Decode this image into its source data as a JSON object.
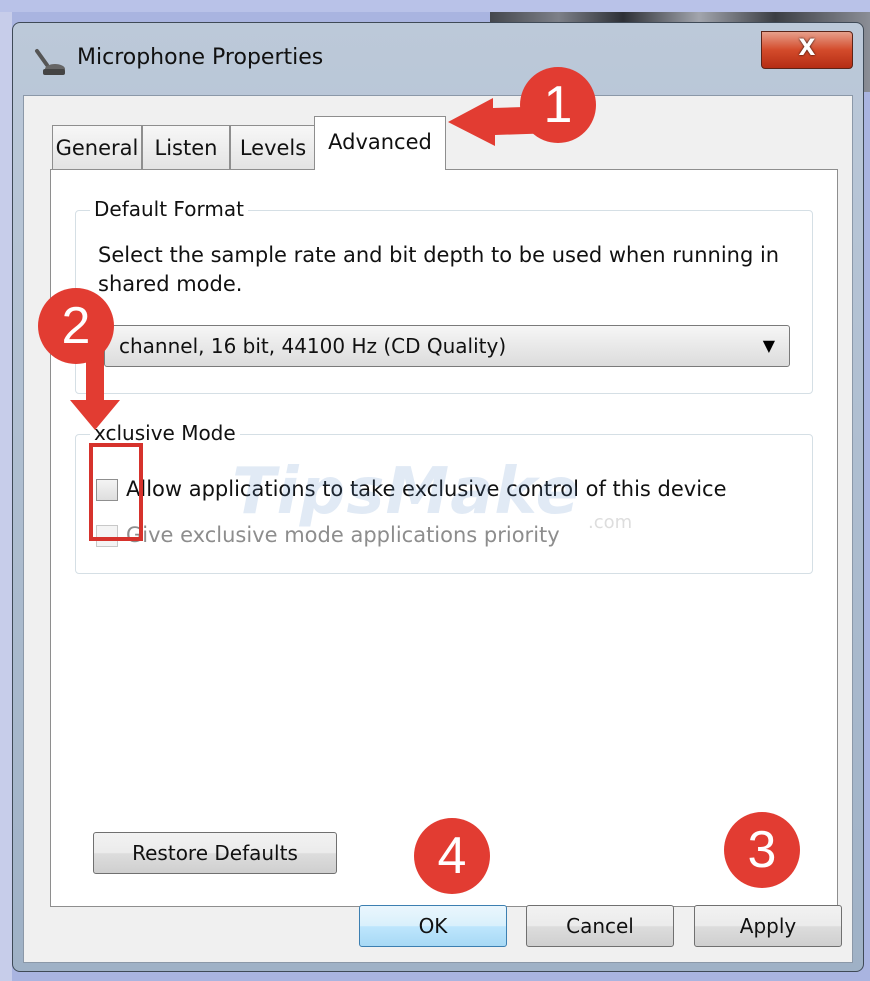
{
  "window": {
    "title": "Microphone Properties",
    "close_label": "X"
  },
  "tabs": [
    {
      "label": "General",
      "active": false
    },
    {
      "label": "Listen",
      "active": false
    },
    {
      "label": "Levels",
      "active": false
    },
    {
      "label": "Advanced",
      "active": true
    }
  ],
  "default_format": {
    "group_label": "Default Format",
    "description": "Select the sample rate and bit depth to be used when running in shared mode.",
    "selected_value": "channel, 16 bit, 44100 Hz (CD Quality)"
  },
  "exclusive_mode": {
    "group_label": "xclusive Mode",
    "allow_label": "Allow applications to take exclusive control of this device",
    "priority_label": "Give exclusive mode applications priority"
  },
  "buttons": {
    "restore_defaults": "Restore Defaults",
    "ok": "OK",
    "cancel": "Cancel",
    "apply": "Apply"
  },
  "annotations": {
    "badge_1": "1",
    "badge_2": "2",
    "badge_3": "3",
    "badge_4": "4",
    "color": "#e23c32"
  },
  "watermark": {
    "text": "TipsMake",
    "suffix": ".com"
  },
  "icons": {
    "title_icon": "microphone-icon",
    "dropdown_icon": "chevron-down-icon"
  }
}
